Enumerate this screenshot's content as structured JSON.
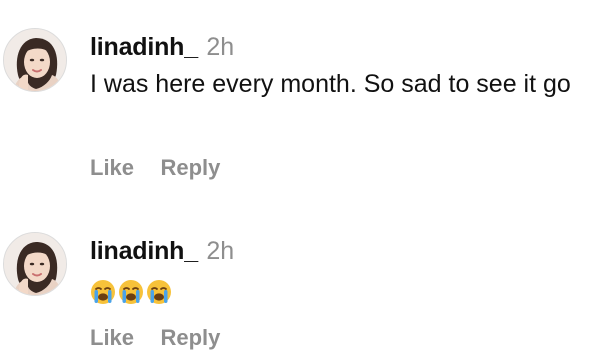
{
  "comments": [
    {
      "username": "linadinh_",
      "time": "2h",
      "text": "I was here every month. So sad to see it go",
      "like_label": "Like",
      "reply_label": "Reply"
    },
    {
      "username": "linadinh_",
      "time": "2h",
      "emojis": [
        "crying-face",
        "crying-face",
        "crying-face"
      ],
      "like_label": "Like",
      "reply_label": "Reply"
    }
  ],
  "colors": {
    "username": "#111111",
    "muted": "#8e8e8e",
    "background": "#ffffff"
  }
}
